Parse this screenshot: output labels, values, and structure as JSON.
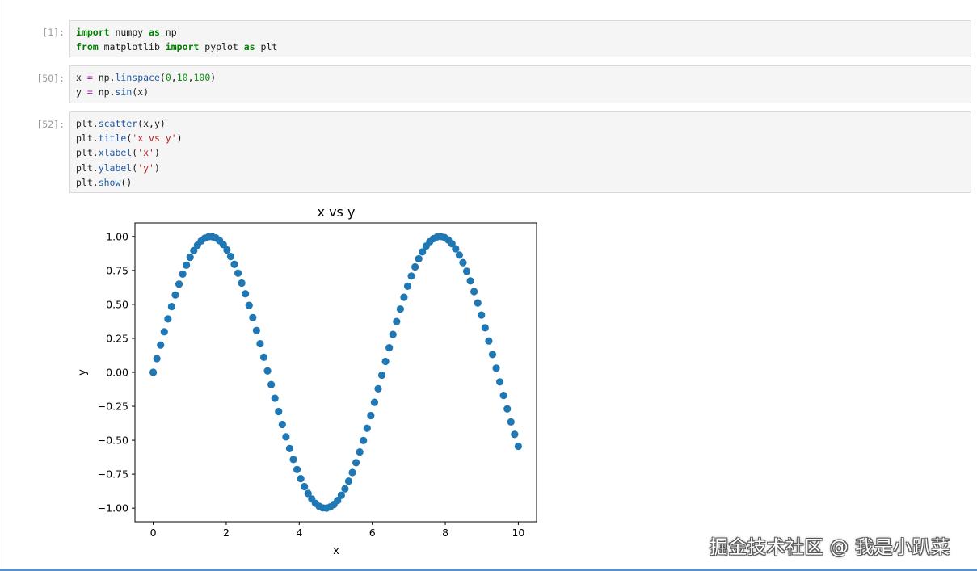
{
  "cells": [
    {
      "prompt": "[1]:",
      "lines": [
        [
          {
            "t": "import",
            "c": "kw"
          },
          {
            "t": " numpy "
          },
          {
            "t": "as",
            "c": "kw"
          },
          {
            "t": " np"
          }
        ],
        [
          {
            "t": "from",
            "c": "kw"
          },
          {
            "t": " matplotlib "
          },
          {
            "t": "import",
            "c": "kw"
          },
          {
            "t": " pyplot "
          },
          {
            "t": "as",
            "c": "kw"
          },
          {
            "t": " plt"
          }
        ]
      ]
    },
    {
      "prompt": "[50]:",
      "lines": [
        [
          {
            "t": "x "
          },
          {
            "t": "=",
            "c": "op"
          },
          {
            "t": " np."
          },
          {
            "t": "linspace",
            "c": "fn"
          },
          {
            "t": "("
          },
          {
            "t": "0",
            "c": "num"
          },
          {
            "t": ","
          },
          {
            "t": "10",
            "c": "num"
          },
          {
            "t": ","
          },
          {
            "t": "100",
            "c": "num"
          },
          {
            "t": ")"
          }
        ],
        [
          {
            "t": "y "
          },
          {
            "t": "=",
            "c": "op"
          },
          {
            "t": " np."
          },
          {
            "t": "sin",
            "c": "fn"
          },
          {
            "t": "(x)"
          }
        ]
      ]
    },
    {
      "prompt": "[52]:",
      "lines": [
        [
          {
            "t": "plt."
          },
          {
            "t": "scatter",
            "c": "fn"
          },
          {
            "t": "(x,y)"
          }
        ],
        [
          {
            "t": "plt."
          },
          {
            "t": "title",
            "c": "fn"
          },
          {
            "t": "("
          },
          {
            "t": "'x vs y'",
            "c": "str"
          },
          {
            "t": ")"
          }
        ],
        [
          {
            "t": "plt."
          },
          {
            "t": "xlabel",
            "c": "fn"
          },
          {
            "t": "("
          },
          {
            "t": "'x'",
            "c": "str"
          },
          {
            "t": ")"
          }
        ],
        [
          {
            "t": "plt."
          },
          {
            "t": "ylabel",
            "c": "fn"
          },
          {
            "t": "("
          },
          {
            "t": "'y'",
            "c": "str"
          },
          {
            "t": ")"
          }
        ],
        [
          {
            "t": "plt."
          },
          {
            "t": "show",
            "c": "fn"
          },
          {
            "t": "()"
          }
        ]
      ]
    }
  ],
  "chart_data": {
    "type": "scatter",
    "title": "x vs y",
    "xlabel": "x",
    "ylabel": "y",
    "x_function": "linspace(0, 10, 100)",
    "y_function": "sin(x)",
    "x_start": 0,
    "x_end": 10,
    "count": 100,
    "xlim": [
      -0.5,
      10.5
    ],
    "ylim": [
      -1.1,
      1.1
    ],
    "xticks": [
      0,
      2,
      4,
      6,
      8,
      10
    ],
    "yticks": [
      1.0,
      0.75,
      0.5,
      0.25,
      0.0,
      -0.25,
      -0.5,
      -0.75,
      -1.0
    ],
    "ytick_labels": [
      "1.00",
      "0.75",
      "0.50",
      "0.25",
      "0.00",
      "−0.25",
      "−0.50",
      "−0.75",
      "−1.00"
    ],
    "grid": false,
    "marker_color": "#1f77b4"
  },
  "watermark": "掘金技术社区 @ 我是小趴菜"
}
